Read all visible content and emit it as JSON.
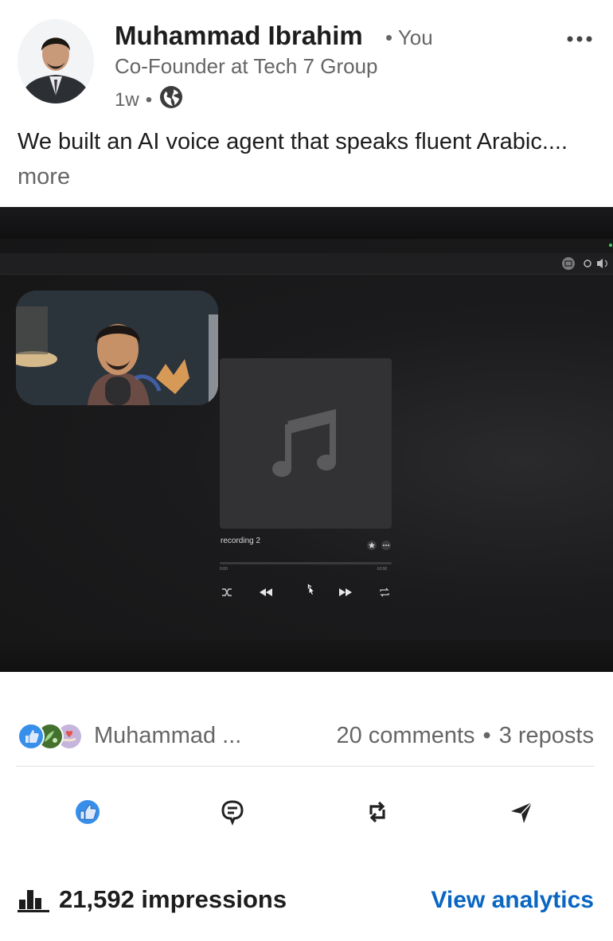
{
  "post": {
    "author": {
      "name": "Muhammad Ibrahim",
      "relation": "• You",
      "headline": "Co-Founder at Tech 7 Group",
      "time": "1w",
      "visibility_icon": "globe-icon"
    },
    "text": "We built an AI voice agent that speaks fluent Arabic....",
    "see_more": "more",
    "menu_icon": "more-horizontal-icon"
  },
  "video": {
    "player": {
      "track_title": "recording 2",
      "time_elapsed": "0:00",
      "time_remaining": "-10:00"
    }
  },
  "social": {
    "reactor": "Muhammad ...",
    "comments": "20 comments",
    "separator": "•",
    "reposts": "3 reposts",
    "reaction_icons": [
      "like-icon",
      "celebrate-icon",
      "support-icon"
    ]
  },
  "actions": [
    {
      "name": "like",
      "icon": "like-icon"
    },
    {
      "name": "comment",
      "icon": "comment-icon"
    },
    {
      "name": "repost",
      "icon": "repost-icon"
    },
    {
      "name": "send",
      "icon": "send-icon"
    }
  ],
  "stats": {
    "impressions": "21,592 impressions",
    "analytics_link": "View analytics"
  },
  "colors": {
    "accent": "#0a66c2",
    "text_primary": "#1d1d1d",
    "text_secondary": "#666666",
    "like_blue": "#378fe9"
  }
}
